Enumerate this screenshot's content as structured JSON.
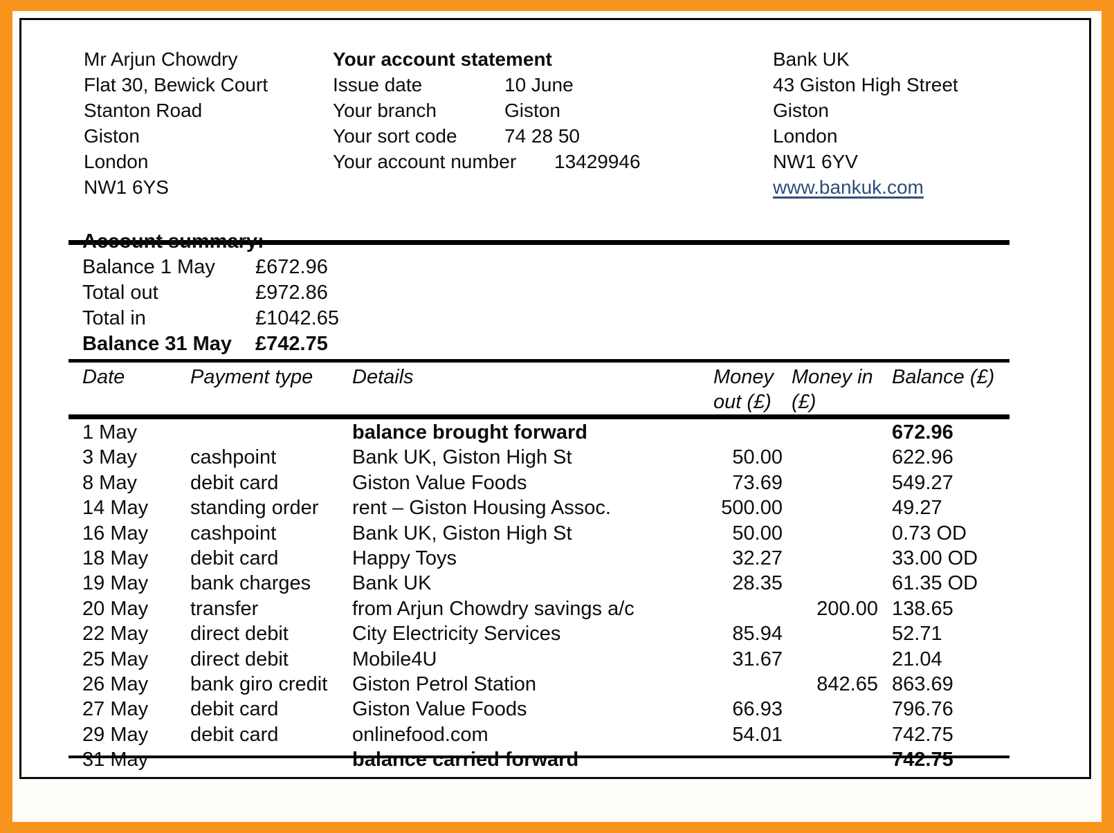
{
  "theme": {
    "frame_color": "#F7941E",
    "border_color": "#0b0b0b",
    "text_color": "#0d0d0d",
    "link_color": "#2E4D7B"
  },
  "customer": {
    "name": "Mr Arjun Chowdry",
    "address_line_1": "Flat 30, Bewick Court",
    "address_line_2": "Stanton Road",
    "address_line_3": "Giston",
    "address_line_4": "London",
    "postcode": "NW1 6YS"
  },
  "statement": {
    "title": "Your account statement",
    "issue_date_label": "Issue date",
    "issue_date_value": "10 June",
    "branch_label": "Your branch",
    "branch_value": "Giston",
    "sort_code_label": "Your sort code",
    "sort_code_value": "74 28 50",
    "account_number_label": "Your account number",
    "account_number_value": "13429946"
  },
  "bank": {
    "name": "Bank UK",
    "address_line_1": "43 Giston High Street",
    "address_line_2": "Giston",
    "address_line_3": "London",
    "postcode": "NW1 6YV",
    "website": "www.bankuk.com"
  },
  "summary": {
    "title": "Account summary:",
    "rows": [
      {
        "label": "Balance 1 May",
        "value": "£672.96"
      },
      {
        "label": "Total out",
        "value": "£972.86"
      },
      {
        "label": "Total in",
        "value": "£1042.65"
      },
      {
        "label": "Balance 31 May",
        "value": "£742.75"
      }
    ]
  },
  "table": {
    "headers": {
      "date": "Date",
      "payment_type": "Payment type",
      "details": "Details",
      "money_out": "Money out (£)",
      "money_in": "Money in (£)",
      "balance": "Balance (£)"
    },
    "rows": [
      {
        "date": "1 May",
        "type": "",
        "details": "balance brought forward",
        "out": "",
        "in": "",
        "balance": "672.96"
      },
      {
        "date": "3 May",
        "type": "cashpoint",
        "details": "Bank UK, Giston High St",
        "out": "50.00",
        "in": "",
        "balance": "622.96"
      },
      {
        "date": "8 May",
        "type": "debit card",
        "details": "Giston Value Foods",
        "out": "73.69",
        "in": "",
        "balance": "549.27"
      },
      {
        "date": "14 May",
        "type": "standing order",
        "details": "rent – Giston Housing Assoc.",
        "out": "500.00",
        "in": "",
        "balance": "49.27"
      },
      {
        "date": "16 May",
        "type": "cashpoint",
        "details": "Bank UK, Giston High St",
        "out": "50.00",
        "in": "",
        "balance": "0.73 OD"
      },
      {
        "date": "18 May",
        "type": "debit card",
        "details": "Happy Toys",
        "out": "32.27",
        "in": "",
        "balance": "33.00 OD"
      },
      {
        "date": "19 May",
        "type": "bank charges",
        "details": "Bank UK",
        "out": "28.35",
        "in": "",
        "balance": "61.35 OD"
      },
      {
        "date": "20 May",
        "type": "transfer",
        "details": "from Arjun Chowdry savings a/c",
        "out": "",
        "in": "200.00",
        "balance": "138.65"
      },
      {
        "date": "22 May",
        "type": "direct debit",
        "details": "City Electricity Services",
        "out": "85.94",
        "in": "",
        "balance": "52.71"
      },
      {
        "date": "25 May",
        "type": "direct debit",
        "details": "Mobile4U",
        "out": "31.67",
        "in": "",
        "balance": "21.04"
      },
      {
        "date": "26 May",
        "type": "bank giro credit",
        "details": "Giston Petrol Station",
        "out": "",
        "in": "842.65",
        "balance": "863.69"
      },
      {
        "date": "27 May",
        "type": "debit card",
        "details": "Giston Value Foods",
        "out": "66.93",
        "in": "",
        "balance": "796.76"
      },
      {
        "date": "29 May",
        "type": "debit card",
        "details": "onlinefood.com",
        "out": "54.01",
        "in": "",
        "balance": "742.75"
      },
      {
        "date": "31 May",
        "type": "",
        "details": "balance carried forward",
        "out": "",
        "in": "",
        "balance": "742.75"
      }
    ],
    "emphasised_row_indexes": [
      0,
      13
    ]
  }
}
